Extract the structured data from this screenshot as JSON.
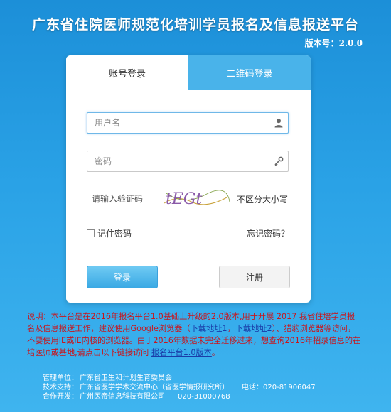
{
  "header": {
    "title": "广东省住院医师规范化培训学员报名及信息报送平台",
    "version": "版本号：2.0.0"
  },
  "login": {
    "tabs": {
      "account": "账号登录",
      "qr": "二维码登录"
    },
    "username_placeholder": "用户名",
    "password_placeholder": "密码",
    "captcha_placeholder": "请输入验证码",
    "captcha_text": "tEGt",
    "captcha_hint": "不区分大小写",
    "remember_label": "记住密码",
    "forgot_label": "忘记密码？",
    "login_button": "登录",
    "register_button": "注册",
    "icons": {
      "user": "user-icon",
      "password": "key-icon"
    }
  },
  "notice": {
    "part1": "说明：本平台是在2016年报名平台1.0基础上升级的2.0版本,用于开展 2017 我省住培学员报名及信息报送工作，建议使用Google浏览器（",
    "link1": "下载地址1",
    "sep": "，",
    "link2": "下载地址2",
    "part2": "）、猎豹浏览器等访问，不要使用IE或IE内核的浏览器。由于2016年数据未完全迁移过来，想查询2016年招录信息的在培医师或基地,请点击以下链接访问",
    "link3": "报名平台1.0版本",
    "end": "。"
  },
  "footer": {
    "manage_label": "管理单位：",
    "manage_value": "广东省卫生和计划生育委员会",
    "tech_label": "技术支持：",
    "tech_value": "广东省医学学术交流中心（省医学情报研究所）",
    "tech_phone": "电话：020-81906047",
    "dev_label": "合作开发：",
    "dev_value": "广州医帝信息科技有限公司",
    "dev_phone": "020-31000768"
  },
  "colors": {
    "background_top": "#1c8fd8",
    "tab_active": "#49b3ea",
    "notice_text": "#c8161d",
    "link": "#1a3da8"
  }
}
